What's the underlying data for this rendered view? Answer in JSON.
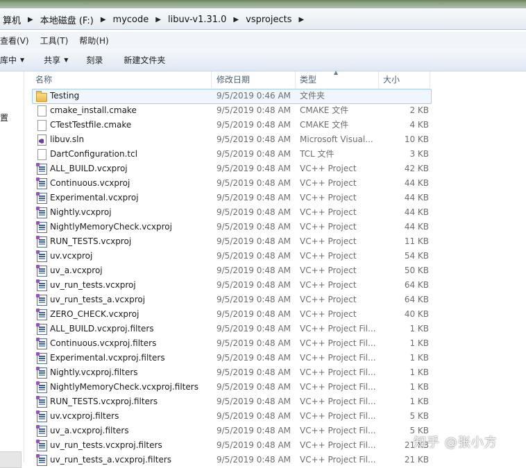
{
  "breadcrumb": [
    "算机",
    "本地磁盘 (F:)",
    "mycode",
    "libuv-v1.31.0",
    "vsprojects"
  ],
  "menu": [
    "查看(V)",
    "工具(T)",
    "帮助(H)"
  ],
  "toolbar": {
    "library_label": "库中",
    "share_label": "共享",
    "burn_label": "刻录",
    "new_folder_label": "新建文件夹"
  },
  "nav": {
    "fragment_label": "置"
  },
  "columns": {
    "name": "名称",
    "date": "修改日期",
    "type": "类型",
    "size": "大小"
  },
  "files": [
    {
      "name": "Testing",
      "date": "9/5/2019 0:46 AM",
      "type": "文件夹",
      "size": "",
      "icon": "folder-icon"
    },
    {
      "name": "cmake_install.cmake",
      "date": "9/5/2019 0:48 AM",
      "type": "CMAKE 文件",
      "size": "2 KB",
      "icon": "document-icon"
    },
    {
      "name": "CTestTestfile.cmake",
      "date": "9/5/2019 0:48 AM",
      "type": "CMAKE 文件",
      "size": "4 KB",
      "icon": "document-icon"
    },
    {
      "name": "libuv.sln",
      "date": "9/5/2019 0:48 AM",
      "type": "Microsoft Visual...",
      "size": "10 KB",
      "icon": "visual-studio-solution-icon"
    },
    {
      "name": "DartConfiguration.tcl",
      "date": "9/5/2019 0:48 AM",
      "type": "TCL 文件",
      "size": "3 KB",
      "icon": "document-icon"
    },
    {
      "name": "ALL_BUILD.vcxproj",
      "date": "9/5/2019 0:48 AM",
      "type": "VC++ Project",
      "size": "42 KB",
      "icon": "vcxproj-icon"
    },
    {
      "name": "Continuous.vcxproj",
      "date": "9/5/2019 0:48 AM",
      "type": "VC++ Project",
      "size": "44 KB",
      "icon": "vcxproj-icon"
    },
    {
      "name": "Experimental.vcxproj",
      "date": "9/5/2019 0:48 AM",
      "type": "VC++ Project",
      "size": "44 KB",
      "icon": "vcxproj-icon"
    },
    {
      "name": "Nightly.vcxproj",
      "date": "9/5/2019 0:48 AM",
      "type": "VC++ Project",
      "size": "44 KB",
      "icon": "vcxproj-icon"
    },
    {
      "name": "NightlyMemoryCheck.vcxproj",
      "date": "9/5/2019 0:48 AM",
      "type": "VC++ Project",
      "size": "44 KB",
      "icon": "vcxproj-icon"
    },
    {
      "name": "RUN_TESTS.vcxproj",
      "date": "9/5/2019 0:48 AM",
      "type": "VC++ Project",
      "size": "11 KB",
      "icon": "vcxproj-icon"
    },
    {
      "name": "uv.vcxproj",
      "date": "9/5/2019 0:48 AM",
      "type": "VC++ Project",
      "size": "54 KB",
      "icon": "vcxproj-icon"
    },
    {
      "name": "uv_a.vcxproj",
      "date": "9/5/2019 0:48 AM",
      "type": "VC++ Project",
      "size": "50 KB",
      "icon": "vcxproj-icon"
    },
    {
      "name": "uv_run_tests.vcxproj",
      "date": "9/5/2019 0:48 AM",
      "type": "VC++ Project",
      "size": "64 KB",
      "icon": "vcxproj-icon"
    },
    {
      "name": "uv_run_tests_a.vcxproj",
      "date": "9/5/2019 0:48 AM",
      "type": "VC++ Project",
      "size": "64 KB",
      "icon": "vcxproj-icon"
    },
    {
      "name": "ZERO_CHECK.vcxproj",
      "date": "9/5/2019 0:48 AM",
      "type": "VC++ Project",
      "size": "40 KB",
      "icon": "vcxproj-icon"
    },
    {
      "name": "ALL_BUILD.vcxproj.filters",
      "date": "9/5/2019 0:48 AM",
      "type": "VC++ Project Fil...",
      "size": "1 KB",
      "icon": "vcxproj-icon"
    },
    {
      "name": "Continuous.vcxproj.filters",
      "date": "9/5/2019 0:48 AM",
      "type": "VC++ Project Fil...",
      "size": "1 KB",
      "icon": "vcxproj-icon"
    },
    {
      "name": "Experimental.vcxproj.filters",
      "date": "9/5/2019 0:48 AM",
      "type": "VC++ Project Fil...",
      "size": "1 KB",
      "icon": "vcxproj-icon"
    },
    {
      "name": "Nightly.vcxproj.filters",
      "date": "9/5/2019 0:48 AM",
      "type": "VC++ Project Fil...",
      "size": "1 KB",
      "icon": "vcxproj-icon"
    },
    {
      "name": "NightlyMemoryCheck.vcxproj.filters",
      "date": "9/5/2019 0:48 AM",
      "type": "VC++ Project Fil...",
      "size": "1 KB",
      "icon": "vcxproj-icon"
    },
    {
      "name": "RUN_TESTS.vcxproj.filters",
      "date": "9/5/2019 0:48 AM",
      "type": "VC++ Project Fil...",
      "size": "1 KB",
      "icon": "vcxproj-icon"
    },
    {
      "name": "uv.vcxproj.filters",
      "date": "9/5/2019 0:48 AM",
      "type": "VC++ Project Fil...",
      "size": "5 KB",
      "icon": "vcxproj-icon"
    },
    {
      "name": "uv_a.vcxproj.filters",
      "date": "9/5/2019 0:48 AM",
      "type": "VC++ Project Fil...",
      "size": "5 KB",
      "icon": "vcxproj-icon"
    },
    {
      "name": "uv_run_tests.vcxproj.filters",
      "date": "9/5/2019 0:48 AM",
      "type": "VC++ Project Fil...",
      "size": "21 KB",
      "icon": "vcxproj-icon"
    },
    {
      "name": "uv_run_tests_a.vcxproj.filters",
      "date": "9/5/2019 0:48 AM",
      "type": "VC++ Project Fil...",
      "size": "21 KB",
      "icon": "vcxproj-icon"
    }
  ],
  "watermark": "知乎 @张小方"
}
